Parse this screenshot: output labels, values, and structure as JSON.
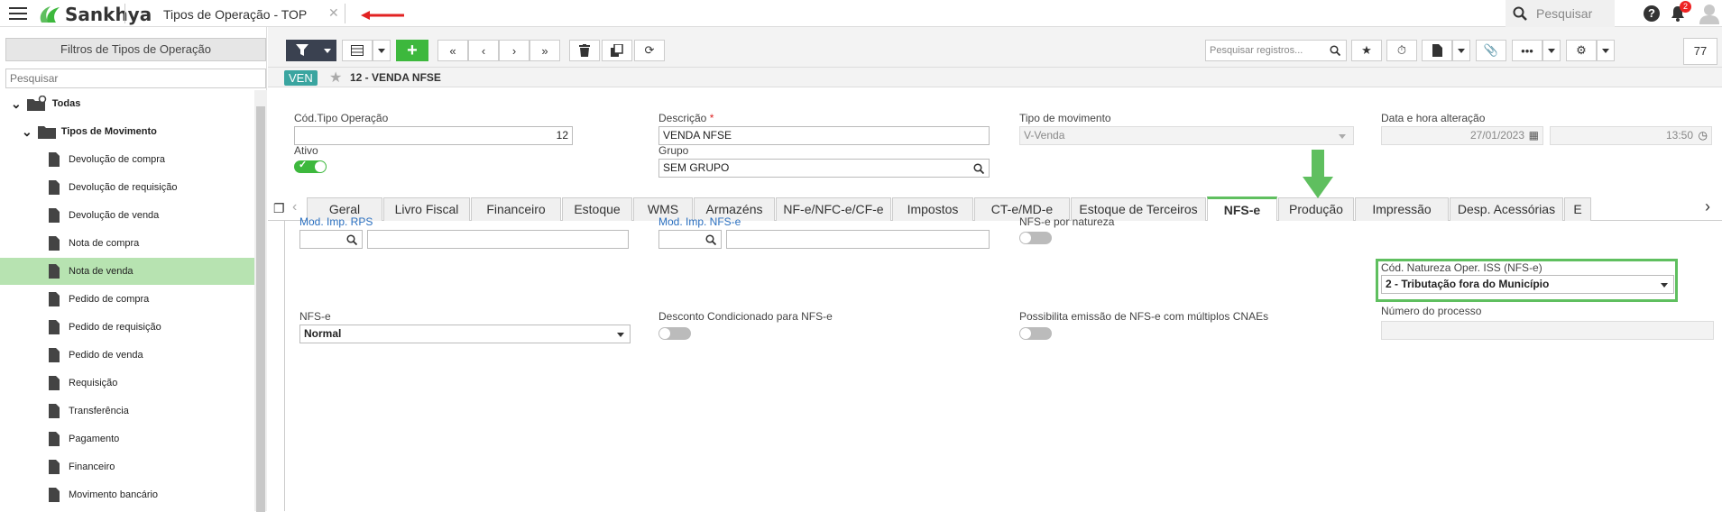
{
  "app": {
    "brand": "Sankhya",
    "window_title": "Tipos de Operação - TOP",
    "global_search_placeholder": "Pesquisar",
    "notification_count": "2"
  },
  "sidebar": {
    "header": "Filtros de Tipos de Operação",
    "search_placeholder": "Pesquisar",
    "items": [
      {
        "label": "Todas"
      },
      {
        "label": "Tipos de Movimento"
      },
      {
        "label": "Devolução de compra"
      },
      {
        "label": "Devolução de requisição"
      },
      {
        "label": "Devolução de venda"
      },
      {
        "label": "Nota de compra"
      },
      {
        "label": "Nota de venda"
      },
      {
        "label": "Pedido de compra"
      },
      {
        "label": "Pedido de requisição"
      },
      {
        "label": "Pedido de venda"
      },
      {
        "label": "Requisição"
      },
      {
        "label": "Transferência"
      },
      {
        "label": "Pagamento"
      },
      {
        "label": "Financeiro"
      },
      {
        "label": "Movimento bancário"
      }
    ],
    "selected": "Nota de venda"
  },
  "toolbar": {
    "search_placeholder": "Pesquisar registros...",
    "record_count": "77"
  },
  "record": {
    "badge": "VEN",
    "title": "12 - VENDA NFSE"
  },
  "form": {
    "cod_label": "Cód.Tipo Operação",
    "cod_value": "12",
    "desc_label": "Descrição",
    "desc_value": "VENDA NFSE",
    "tipo_label": "Tipo de movimento",
    "tipo_value": "V-Venda",
    "data_label": "Data e hora alteração",
    "data_value": "27/01/2023",
    "hora_value": "13:50",
    "ativo_label": "Ativo",
    "grupo_label": "Grupo",
    "grupo_value": "SEM GRUPO"
  },
  "tabs": [
    {
      "label": "Geral"
    },
    {
      "label": "Livro Fiscal"
    },
    {
      "label": "Financeiro"
    },
    {
      "label": "Estoque"
    },
    {
      "label": "WMS"
    },
    {
      "label": "Armazéns"
    },
    {
      "label": "NF-e/NFC-e/CF-e"
    },
    {
      "label": "Impostos"
    },
    {
      "label": "CT-e/MD-e"
    },
    {
      "label": "Estoque de Terceiros"
    },
    {
      "label": "NFS-e"
    },
    {
      "label": "Produção"
    },
    {
      "label": "Impressão"
    },
    {
      "label": "Desp. Acessórias"
    },
    {
      "label": "E"
    }
  ],
  "active_tab": "NFS-e",
  "nfse": {
    "mod_rps_label": "Mod. Imp. RPS",
    "mod_nfse_label": "Mod. Imp. NFS-e",
    "por_natureza_label": "NFS-e por natureza",
    "cod_natureza_label": "Cód. Natureza Oper. ISS (NFS-e)",
    "cod_natureza_value": "2 - Tributação fora do Município",
    "numero_processo_label": "Número do processo",
    "nfse_label": "NFS-e",
    "nfse_value": "Normal",
    "desconto_label": "Desconto Condicionado para NFS-e",
    "multiplos_label": "Possibilita emissão de NFS-e com múltiplos CNAEs"
  },
  "colors": {
    "accent_green": "#3db83d",
    "highlight_green": "#5fbf5f",
    "selected_row": "#b7e3b1",
    "badge_teal": "#3aa5a0",
    "arrow_red": "#e22222"
  }
}
